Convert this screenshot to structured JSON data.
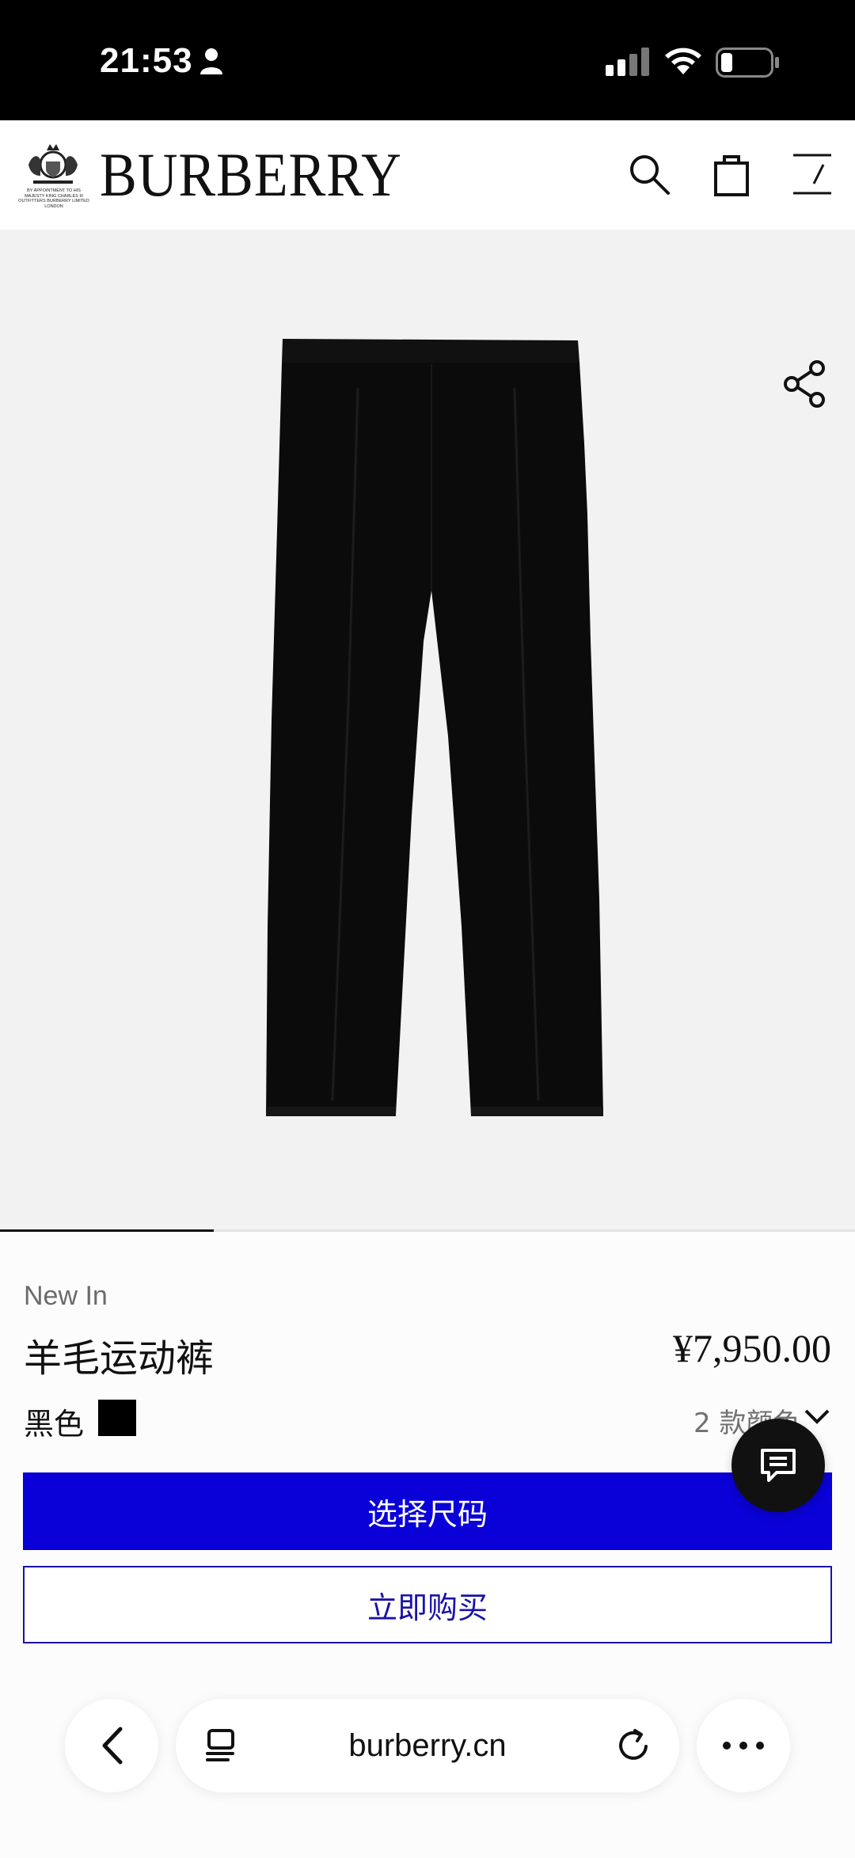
{
  "status_bar": {
    "time": "21:53"
  },
  "header": {
    "brand": "BURBERRY",
    "crest_text": "By Appointment to His Majesty King Charles III Outfitters Burberry Limited London"
  },
  "gallery": {
    "current_image_index": 1,
    "image_count": 4
  },
  "product": {
    "badge": "New In",
    "name": "羊毛运动裤",
    "price": "¥7,950.00",
    "color_name": "黑色",
    "color_swatch": "#000000",
    "color_count": "2 款颜色"
  },
  "actions": {
    "select_size": "选择尺码",
    "buy_now": "立即购买"
  },
  "browser": {
    "url": "burberry.cn"
  },
  "colors": {
    "primary_button": "#0a00d8",
    "secondary_border": "#1b12a8"
  }
}
